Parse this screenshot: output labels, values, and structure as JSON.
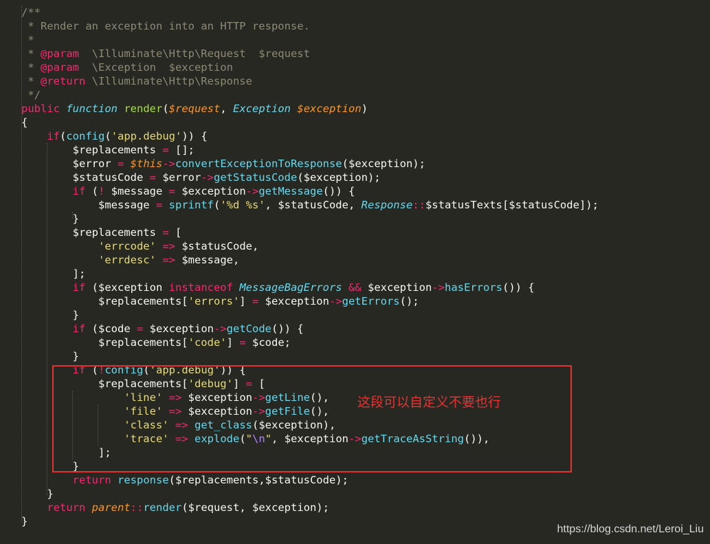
{
  "editor": {
    "theme": "monokai",
    "colors": {
      "background": "#272822",
      "text": "#f8f8f2",
      "comment": "#8d8a76",
      "keyword": "#f92672",
      "function": "#a6e22e",
      "variable": "#fd971f",
      "class": "#66d9ef",
      "string": "#e6db74"
    }
  },
  "code_lines": [
    [
      [
        "comment",
        "/**"
      ]
    ],
    [
      [
        "comment",
        " * Render an exception into an HTTP response."
      ]
    ],
    [
      [
        "comment",
        " *"
      ]
    ],
    [
      [
        "comment",
        " * "
      ],
      [
        "doctag",
        "@param"
      ],
      [
        "comment",
        "  \\Illuminate\\Http\\Request  $request"
      ]
    ],
    [
      [
        "comment",
        " * "
      ],
      [
        "doctag",
        "@param"
      ],
      [
        "comment",
        "  \\Exception  $exception"
      ]
    ],
    [
      [
        "comment",
        " * "
      ],
      [
        "doctag",
        "@return"
      ],
      [
        "comment",
        " \\Illuminate\\Http\\Response"
      ]
    ],
    [
      [
        "comment",
        " */"
      ]
    ],
    [
      [
        "keyword",
        "public"
      ],
      [
        "plain",
        " "
      ],
      [
        "storage",
        "function"
      ],
      [
        "plain",
        " "
      ],
      [
        "fn",
        "render"
      ],
      [
        "plain",
        "("
      ],
      [
        "var",
        "$request"
      ],
      [
        "plain",
        ", "
      ],
      [
        "class",
        "Exception"
      ],
      [
        "plain",
        " "
      ],
      [
        "var",
        "$exception"
      ],
      [
        "plain",
        ")"
      ]
    ],
    [
      [
        "plain",
        "{"
      ]
    ],
    [
      [
        "plain",
        "    "
      ],
      [
        "keyword",
        "if"
      ],
      [
        "plain",
        "("
      ],
      [
        "call",
        "config"
      ],
      [
        "plain",
        "("
      ],
      [
        "string",
        "'app.debug'"
      ],
      [
        "plain",
        ")) {"
      ]
    ],
    [
      [
        "plain",
        "        $replacements "
      ],
      [
        "op",
        "="
      ],
      [
        "plain",
        " [];"
      ]
    ],
    [
      [
        "plain",
        "        $error "
      ],
      [
        "op",
        "="
      ],
      [
        "plain",
        " "
      ],
      [
        "var",
        "$this"
      ],
      [
        "op",
        "->"
      ],
      [
        "call",
        "convertExceptionToResponse"
      ],
      [
        "plain",
        "($exception);"
      ]
    ],
    [
      [
        "plain",
        "        $statusCode "
      ],
      [
        "op",
        "="
      ],
      [
        "plain",
        " $error"
      ],
      [
        "op",
        "->"
      ],
      [
        "call",
        "getStatusCode"
      ],
      [
        "plain",
        "($exception);"
      ]
    ],
    [
      [
        "plain",
        "        "
      ],
      [
        "keyword",
        "if"
      ],
      [
        "plain",
        " ("
      ],
      [
        "op",
        "!"
      ],
      [
        "plain",
        " $message "
      ],
      [
        "op",
        "="
      ],
      [
        "plain",
        " $exception"
      ],
      [
        "op",
        "->"
      ],
      [
        "call",
        "getMessage"
      ],
      [
        "plain",
        "()) {"
      ]
    ],
    [
      [
        "plain",
        "            $message "
      ],
      [
        "op",
        "="
      ],
      [
        "plain",
        " "
      ],
      [
        "call",
        "sprintf"
      ],
      [
        "plain",
        "("
      ],
      [
        "string",
        "'%d %s'"
      ],
      [
        "plain",
        ", $statusCode, "
      ],
      [
        "class",
        "Response"
      ],
      [
        "op",
        "::"
      ],
      [
        "plain",
        "$statusTexts[$statusCode]);"
      ]
    ],
    [
      [
        "plain",
        "        }"
      ]
    ],
    [
      [
        "plain",
        "        $replacements "
      ],
      [
        "op",
        "="
      ],
      [
        "plain",
        " ["
      ]
    ],
    [
      [
        "plain",
        "            "
      ],
      [
        "string",
        "'errcode'"
      ],
      [
        "plain",
        " "
      ],
      [
        "op",
        "=>"
      ],
      [
        "plain",
        " $statusCode,"
      ]
    ],
    [
      [
        "plain",
        "            "
      ],
      [
        "string",
        "'errdesc'"
      ],
      [
        "plain",
        " "
      ],
      [
        "op",
        "=>"
      ],
      [
        "plain",
        " $message,"
      ]
    ],
    [
      [
        "plain",
        "        ];"
      ]
    ],
    [
      [
        "plain",
        "        "
      ],
      [
        "keyword",
        "if"
      ],
      [
        "plain",
        " ($exception "
      ],
      [
        "keyword",
        "instanceof"
      ],
      [
        "plain",
        " "
      ],
      [
        "class",
        "MessageBagErrors"
      ],
      [
        "plain",
        " "
      ],
      [
        "op",
        "&&"
      ],
      [
        "plain",
        " $exception"
      ],
      [
        "op",
        "->"
      ],
      [
        "call",
        "hasErrors"
      ],
      [
        "plain",
        "()) {"
      ]
    ],
    [
      [
        "plain",
        "            $replacements["
      ],
      [
        "string",
        "'errors'"
      ],
      [
        "plain",
        "] "
      ],
      [
        "op",
        "="
      ],
      [
        "plain",
        " $exception"
      ],
      [
        "op",
        "->"
      ],
      [
        "call",
        "getErrors"
      ],
      [
        "plain",
        "();"
      ]
    ],
    [
      [
        "plain",
        "        }"
      ]
    ],
    [
      [
        "plain",
        "        "
      ],
      [
        "keyword",
        "if"
      ],
      [
        "plain",
        " ($code "
      ],
      [
        "op",
        "="
      ],
      [
        "plain",
        " $exception"
      ],
      [
        "op",
        "->"
      ],
      [
        "call",
        "getCode"
      ],
      [
        "plain",
        "()) {"
      ]
    ],
    [
      [
        "plain",
        "            $replacements["
      ],
      [
        "string",
        "'code'"
      ],
      [
        "plain",
        "] "
      ],
      [
        "op",
        "="
      ],
      [
        "plain",
        " $code;"
      ]
    ],
    [
      [
        "plain",
        "        }"
      ]
    ],
    [
      [
        "plain",
        "        "
      ],
      [
        "keyword",
        "if"
      ],
      [
        "plain",
        " ("
      ],
      [
        "op",
        "!"
      ],
      [
        "call",
        "config"
      ],
      [
        "plain",
        "("
      ],
      [
        "string",
        "'app.debug'"
      ],
      [
        "plain",
        ")) {"
      ]
    ],
    [
      [
        "plain",
        "            $replacements["
      ],
      [
        "string",
        "'debug'"
      ],
      [
        "plain",
        "] "
      ],
      [
        "op",
        "="
      ],
      [
        "plain",
        " ["
      ]
    ],
    [
      [
        "plain",
        "                "
      ],
      [
        "string",
        "'line'"
      ],
      [
        "plain",
        " "
      ],
      [
        "op",
        "=>"
      ],
      [
        "plain",
        " $exception"
      ],
      [
        "op",
        "->"
      ],
      [
        "call",
        "getLine"
      ],
      [
        "plain",
        "(),"
      ]
    ],
    [
      [
        "plain",
        "                "
      ],
      [
        "string",
        "'file'"
      ],
      [
        "plain",
        " "
      ],
      [
        "op",
        "=>"
      ],
      [
        "plain",
        " $exception"
      ],
      [
        "op",
        "->"
      ],
      [
        "call",
        "getFile"
      ],
      [
        "plain",
        "(),"
      ]
    ],
    [
      [
        "plain",
        "                "
      ],
      [
        "string",
        "'class'"
      ],
      [
        "plain",
        " "
      ],
      [
        "op",
        "=>"
      ],
      [
        "plain",
        " "
      ],
      [
        "call",
        "get_class"
      ],
      [
        "plain",
        "($exception),"
      ]
    ],
    [
      [
        "plain",
        "                "
      ],
      [
        "string",
        "'trace'"
      ],
      [
        "plain",
        " "
      ],
      [
        "op",
        "=>"
      ],
      [
        "plain",
        " "
      ],
      [
        "call",
        "explode"
      ],
      [
        "plain",
        "("
      ],
      [
        "string",
        "\""
      ],
      [
        "escape",
        "\\n"
      ],
      [
        "string",
        "\""
      ],
      [
        "plain",
        ", $exception"
      ],
      [
        "op",
        "->"
      ],
      [
        "call",
        "getTraceAsString"
      ],
      [
        "plain",
        "()),"
      ]
    ],
    [
      [
        "plain",
        "            ];"
      ]
    ],
    [
      [
        "plain",
        "        }"
      ]
    ],
    [
      [
        "plain",
        "        "
      ],
      [
        "keyword",
        "return"
      ],
      [
        "plain",
        " "
      ],
      [
        "call",
        "response"
      ],
      [
        "plain",
        "($replacements,$statusCode);"
      ]
    ],
    [
      [
        "plain",
        "    }"
      ]
    ],
    [
      [
        "plain",
        "    "
      ],
      [
        "keyword",
        "return"
      ],
      [
        "plain",
        " "
      ],
      [
        "parent",
        "parent"
      ],
      [
        "op",
        "::"
      ],
      [
        "call",
        "render"
      ],
      [
        "plain",
        "($request, $exception);"
      ]
    ],
    [
      [
        "plain",
        "}"
      ]
    ]
  ],
  "annotation": {
    "text": "这段可以自定义不要也行",
    "color": "#e53333"
  },
  "watermark": {
    "text": "https://blog.csdn.net/Leroi_Liu"
  }
}
